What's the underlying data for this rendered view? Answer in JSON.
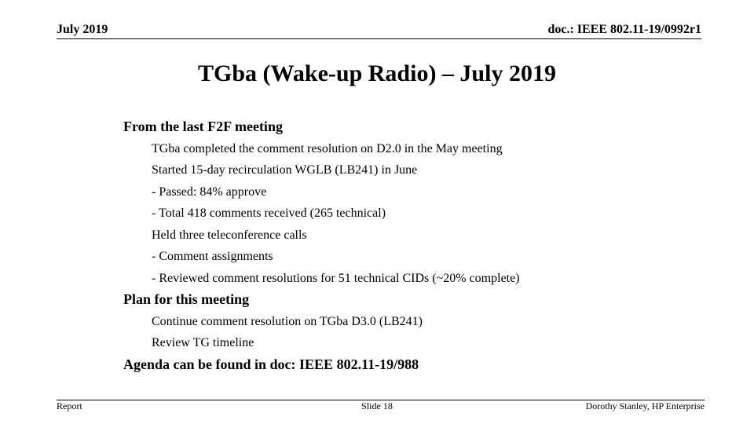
{
  "header": {
    "date": "July 2019",
    "doc_id": "doc.: IEEE 802.11-19/0992r1"
  },
  "title": "TGba (Wake-up Radio) – July 2019",
  "sections": [
    {
      "heading": "From the last F2F meeting",
      "items": [
        "TGba completed the comment resolution on D2.0 in the May meeting",
        "Started 15-day recirculation WGLB (LB241) in June",
        "- Passed: 84% approve",
        "- Total 418 comments received (265 technical)",
        "Held three teleconference calls",
        "- Comment assignments",
        "- Reviewed comment resolutions for 51 technical CIDs (~20% complete)"
      ]
    },
    {
      "heading": "Plan for this meeting",
      "items": [
        "Continue comment resolution on TGba D3.0 (LB241)",
        "Review TG timeline"
      ]
    },
    {
      "heading": "Agenda can be found in doc: IEEE 802.11-19/988",
      "items": []
    }
  ],
  "footer": {
    "left": "Report",
    "center": "Slide 18",
    "right": "Dorothy Stanley, HP Enterprise"
  }
}
